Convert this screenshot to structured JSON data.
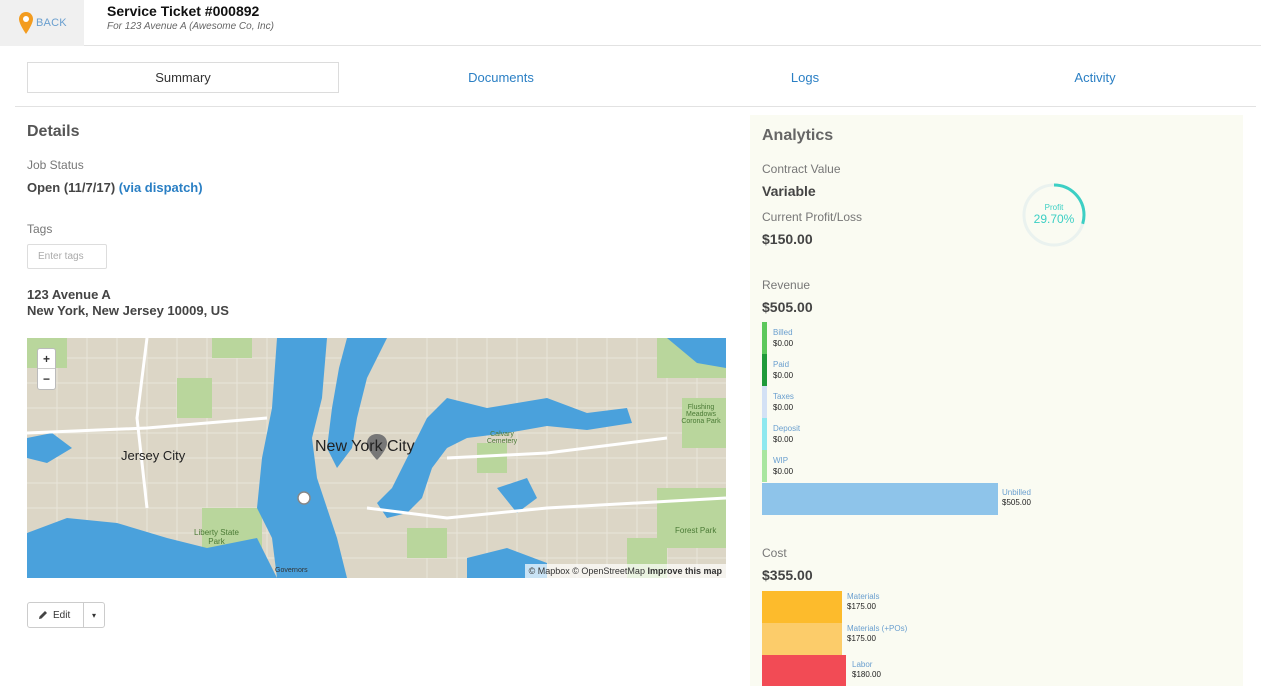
{
  "header": {
    "back_label": "BACK",
    "title": "Service Ticket #000892",
    "subtitle": "For 123 Avenue A (Awesome Co, Inc)"
  },
  "tabs": [
    {
      "label": "Summary",
      "active": true
    },
    {
      "label": "Documents",
      "active": false
    },
    {
      "label": "Logs",
      "active": false
    },
    {
      "label": "Activity",
      "active": false
    }
  ],
  "details": {
    "heading": "Details",
    "job_status_label": "Job Status",
    "job_status_value": "Open (11/7/17)",
    "job_status_link": "(via dispatch)",
    "tags_label": "Tags",
    "tags_placeholder": "Enter tags",
    "address_line1": "123 Avenue A",
    "address_line2": "New York, New Jersey 10009, US"
  },
  "map": {
    "labels": {
      "nyc": "New York City",
      "jersey": "Jersey City",
      "liberty": "Liberty State Park",
      "flushing": "Flushing Meadows Corona Park",
      "calvary": "Calvary Cemetery",
      "forest": "Forest Park",
      "governors": "Governors"
    },
    "attribution": "© Mapbox © OpenStreetMap",
    "improve": "Improve this map",
    "zoom_in": "+",
    "zoom_out": "−"
  },
  "edit_button": {
    "label": "Edit",
    "caret": "▾"
  },
  "analytics": {
    "title": "Analytics",
    "contract_value_label": "Contract Value",
    "contract_value": "Variable",
    "profit_loss_label": "Current Profit/Loss",
    "profit_loss": "$150.00",
    "profit_ring_label": "Profit",
    "profit_percent": "29.70%",
    "profit_fraction": 0.297,
    "revenue_label": "Revenue",
    "revenue_total": "$505.00",
    "revenue_items": [
      {
        "name": "Billed",
        "amount": "$0.00",
        "color": "#5cc85c"
      },
      {
        "name": "Paid",
        "amount": "$0.00",
        "color": "#1f9a3a"
      },
      {
        "name": "Taxes",
        "amount": "$0.00",
        "color": "#d3e1f5"
      },
      {
        "name": "Deposit",
        "amount": "$0.00",
        "color": "#8ee8ef"
      },
      {
        "name": "WIP",
        "amount": "$0.00",
        "color": "#a8e6a0"
      }
    ],
    "unbilled": {
      "name": "Unbilled",
      "amount": "$505.00",
      "color": "#8ec4ea"
    },
    "cost_label": "Cost",
    "cost_total": "$355.00",
    "cost_items": [
      {
        "name": "Materials",
        "amount": "$175.00",
        "color": "#fdbb2c"
      },
      {
        "name": "Materials (+POs)",
        "amount": "$175.00",
        "color": "#fccc6a"
      },
      {
        "name": "Labor",
        "amount": "$180.00",
        "color": "#f24b55"
      }
    ]
  }
}
